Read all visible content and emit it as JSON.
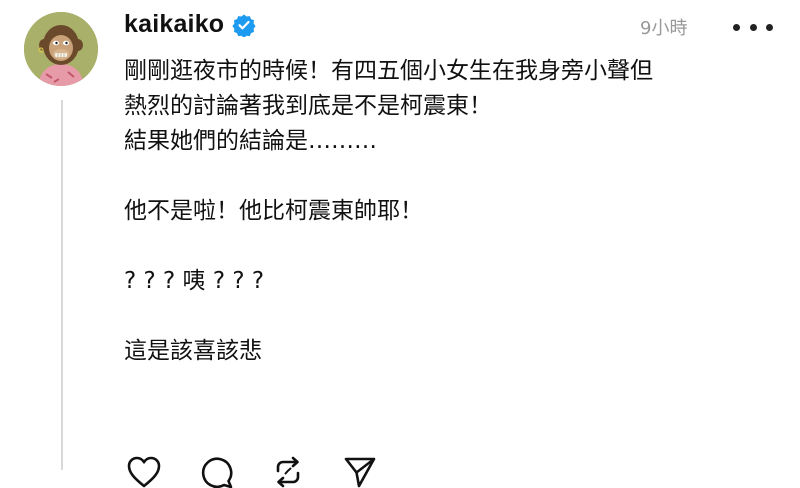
{
  "post": {
    "username": "kaikaiko",
    "verified": true,
    "timestamp": "9小時",
    "lines": [
      "剛剛逛夜市的時候！有四五個小女生在我身旁小聲但",
      "熱烈的討論著我到底是不是柯震東！",
      "結果她們的結論是………",
      "",
      "他不是啦！他比柯震東帥耶！",
      "",
      "? ? ? 咦 ? ? ?",
      "",
      "這是該喜該悲"
    ]
  },
  "icons": {
    "avatar": "cartoon-ape-avatar",
    "verified": "verified-badge-icon",
    "more": "more-options-icon",
    "like": "heart-icon",
    "comment": "comment-icon",
    "repost": "repost-icon",
    "share": "send-icon"
  },
  "colors": {
    "verified": "#1d9bf0",
    "timestamp": "#999999",
    "thread_line": "#d9d9d9"
  }
}
